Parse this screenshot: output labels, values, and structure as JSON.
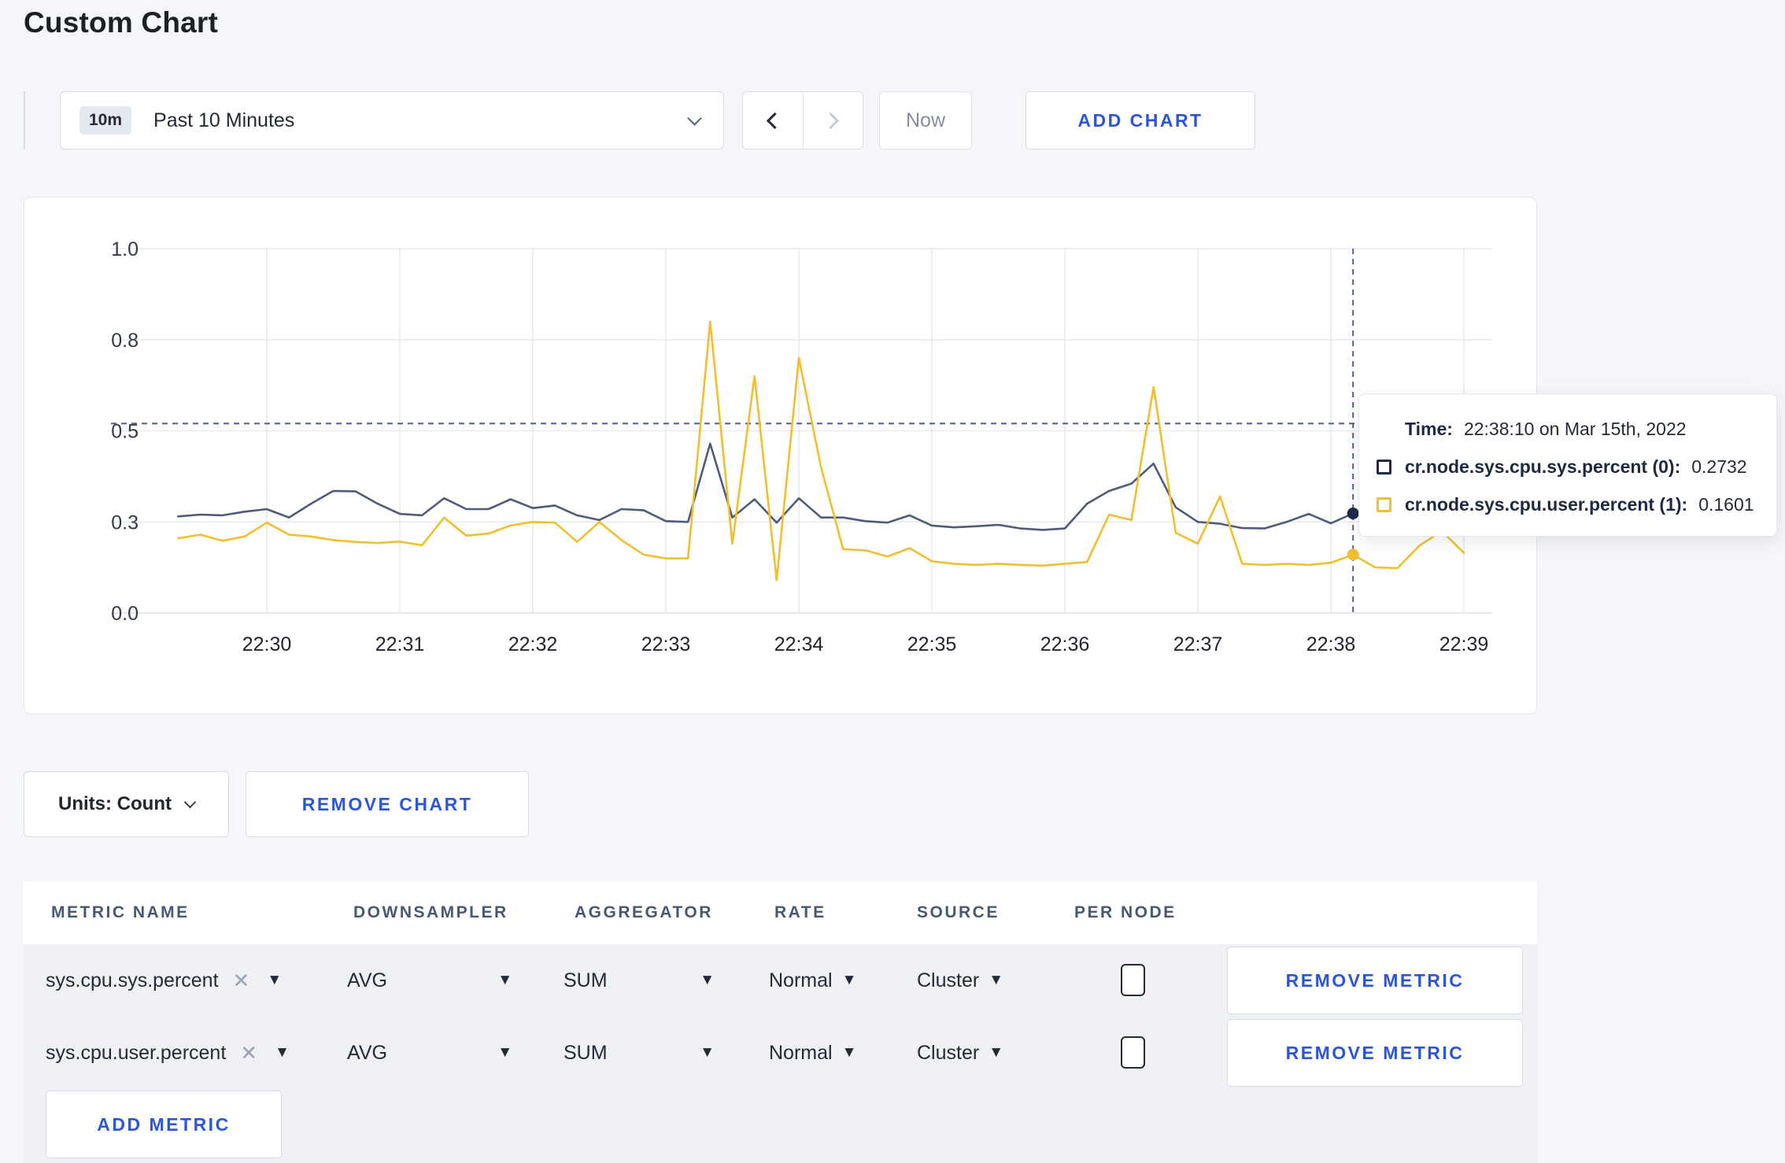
{
  "page": {
    "title": "Custom Chart",
    "background": "#f5f6f9"
  },
  "toolbar": {
    "time_range": {
      "badge": "10m",
      "label": "Past 10 Minutes"
    },
    "now_label": "Now",
    "add_chart_label": "ADD CHART"
  },
  "chart_data": {
    "type": "line",
    "title": "Custom Chart (cr.node.sys.cpu.sys.percent, cr.node.sys.cpu.user.percent)",
    "xlabel": "",
    "ylabel": "",
    "units": "Count",
    "grid": true,
    "ylim": [
      0,
      1
    ],
    "x_range_seconds_from_2230": [
      -40,
      540
    ],
    "sample_interval_seconds": 10,
    "y_ticks": [
      {
        "v": 0,
        "label": "0.0"
      },
      {
        "v": 0.25,
        "label": "0.3"
      },
      {
        "v": 0.5,
        "label": "0.5"
      },
      {
        "v": 0.75,
        "label": "0.8"
      },
      {
        "v": 1,
        "label": "1.0"
      }
    ],
    "x_ticks": [
      {
        "t": 0,
        "label": "22:30"
      },
      {
        "t": 60,
        "label": "22:31"
      },
      {
        "t": 120,
        "label": "22:32"
      },
      {
        "t": 180,
        "label": "22:33"
      },
      {
        "t": 240,
        "label": "22:34"
      },
      {
        "t": 300,
        "label": "22:35"
      },
      {
        "t": 360,
        "label": "22:36"
      },
      {
        "t": 420,
        "label": "22:37"
      },
      {
        "t": 480,
        "label": "22:38"
      },
      {
        "t": 540,
        "label": "22:39"
      }
    ],
    "crosshair": {
      "t": 490,
      "h_value": 0.52,
      "color": "#51618a"
    },
    "hover_points": [
      {
        "series": 0,
        "t": 490,
        "v": 0.2732
      },
      {
        "series": 1,
        "t": 490,
        "v": 0.1601
      }
    ],
    "series": [
      {
        "name": "cr.node.sys.cpu.sys.percent (0)",
        "color": "#4e5c7a",
        "points": [
          [
            -40,
            0.265
          ],
          [
            -30,
            0.27
          ],
          [
            -20,
            0.268
          ],
          [
            -10,
            0.278
          ],
          [
            0,
            0.285
          ],
          [
            10,
            0.262
          ],
          [
            20,
            0.3
          ],
          [
            30,
            0.335
          ],
          [
            40,
            0.334
          ],
          [
            50,
            0.3
          ],
          [
            60,
            0.272
          ],
          [
            70,
            0.268
          ],
          [
            80,
            0.315
          ],
          [
            90,
            0.285
          ],
          [
            100,
            0.285
          ],
          [
            110,
            0.312
          ],
          [
            120,
            0.288
          ],
          [
            130,
            0.295
          ],
          [
            140,
            0.268
          ],
          [
            150,
            0.255
          ],
          [
            160,
            0.285
          ],
          [
            170,
            0.282
          ],
          [
            180,
            0.252
          ],
          [
            190,
            0.25
          ],
          [
            200,
            0.465
          ],
          [
            210,
            0.262
          ],
          [
            220,
            0.312
          ],
          [
            230,
            0.248
          ],
          [
            240,
            0.315
          ],
          [
            250,
            0.262
          ],
          [
            260,
            0.262
          ],
          [
            270,
            0.252
          ],
          [
            280,
            0.248
          ],
          [
            290,
            0.268
          ],
          [
            300,
            0.24
          ],
          [
            310,
            0.235
          ],
          [
            320,
            0.238
          ],
          [
            330,
            0.242
          ],
          [
            340,
            0.232
          ],
          [
            350,
            0.228
          ],
          [
            360,
            0.232
          ],
          [
            370,
            0.3
          ],
          [
            380,
            0.335
          ],
          [
            390,
            0.355
          ],
          [
            400,
            0.41
          ],
          [
            410,
            0.29
          ],
          [
            420,
            0.25
          ],
          [
            430,
            0.245
          ],
          [
            440,
            0.233
          ],
          [
            450,
            0.232
          ],
          [
            460,
            0.25
          ],
          [
            470,
            0.272
          ],
          [
            480,
            0.246
          ],
          [
            490,
            0.2732
          ],
          [
            500,
            0.253
          ],
          [
            510,
            0.262
          ],
          [
            520,
            0.285
          ],
          [
            530,
            0.3
          ],
          [
            540,
            0.298
          ]
        ]
      },
      {
        "name": "cr.node.sys.cpu.user.percent (1)",
        "color": "#f2be2c",
        "points": [
          [
            -40,
            0.205
          ],
          [
            -30,
            0.215
          ],
          [
            -20,
            0.198
          ],
          [
            -10,
            0.21
          ],
          [
            0,
            0.248
          ],
          [
            10,
            0.215
          ],
          [
            20,
            0.21
          ],
          [
            30,
            0.2
          ],
          [
            40,
            0.195
          ],
          [
            50,
            0.192
          ],
          [
            60,
            0.196
          ],
          [
            70,
            0.186
          ],
          [
            80,
            0.262
          ],
          [
            90,
            0.212
          ],
          [
            100,
            0.218
          ],
          [
            110,
            0.24
          ],
          [
            120,
            0.25
          ],
          [
            130,
            0.248
          ],
          [
            140,
            0.195
          ],
          [
            150,
            0.25
          ],
          [
            160,
            0.2
          ],
          [
            170,
            0.16
          ],
          [
            180,
            0.15
          ],
          [
            190,
            0.15
          ],
          [
            200,
            0.8
          ],
          [
            210,
            0.19
          ],
          [
            220,
            0.65
          ],
          [
            230,
            0.09
          ],
          [
            240,
            0.7
          ],
          [
            250,
            0.4
          ],
          [
            260,
            0.175
          ],
          [
            270,
            0.172
          ],
          [
            280,
            0.155
          ],
          [
            290,
            0.178
          ],
          [
            300,
            0.142
          ],
          [
            310,
            0.135
          ],
          [
            320,
            0.132
          ],
          [
            330,
            0.135
          ],
          [
            340,
            0.132
          ],
          [
            350,
            0.13
          ],
          [
            360,
            0.135
          ],
          [
            370,
            0.14
          ],
          [
            380,
            0.27
          ],
          [
            390,
            0.255
          ],
          [
            400,
            0.62
          ],
          [
            410,
            0.22
          ],
          [
            420,
            0.19
          ],
          [
            430,
            0.32
          ],
          [
            440,
            0.135
          ],
          [
            450,
            0.132
          ],
          [
            460,
            0.135
          ],
          [
            470,
            0.132
          ],
          [
            480,
            0.138
          ],
          [
            490,
            0.1601
          ],
          [
            500,
            0.125
          ],
          [
            510,
            0.123
          ],
          [
            520,
            0.185
          ],
          [
            530,
            0.225
          ],
          [
            540,
            0.165
          ]
        ]
      }
    ]
  },
  "tooltip": {
    "time_label": "Time:",
    "time_value": "22:38:10 on Mar 15th, 2022",
    "rows": [
      {
        "name": "cr.node.sys.cpu.sys.percent (0):",
        "value": "0.2732",
        "color": "#1f2a47"
      },
      {
        "name": "cr.node.sys.cpu.user.percent (1):",
        "value": "0.1601",
        "color": "#f2be2c"
      }
    ]
  },
  "chart_footer": {
    "units_label": "Units: Count",
    "remove_chart_label": "REMOVE CHART"
  },
  "metrics_table": {
    "headers": [
      "METRIC NAME",
      "DOWNSAMPLER",
      "AGGREGATOR",
      "RATE",
      "SOURCE",
      "PER NODE"
    ],
    "remove_metric_label": "REMOVE METRIC",
    "add_metric_label": "ADD METRIC",
    "rows": [
      {
        "metric": "sys.cpu.sys.percent",
        "downsampler": "AVG",
        "aggregator": "SUM",
        "rate": "Normal",
        "source": "Cluster",
        "per_node_checked": false
      },
      {
        "metric": "sys.cpu.user.percent",
        "downsampler": "AVG",
        "aggregator": "SUM",
        "rate": "Normal",
        "source": "Cluster",
        "per_node_checked": false
      }
    ]
  },
  "colors": {
    "accent_blue": "#2b55db",
    "series_sys": "#4e5c7a",
    "series_user": "#f2be2c",
    "grid": "#e7e9ee",
    "page_bg": "#f5f6f9",
    "row_bg": "#eef0f4",
    "header_text": "#475872"
  }
}
